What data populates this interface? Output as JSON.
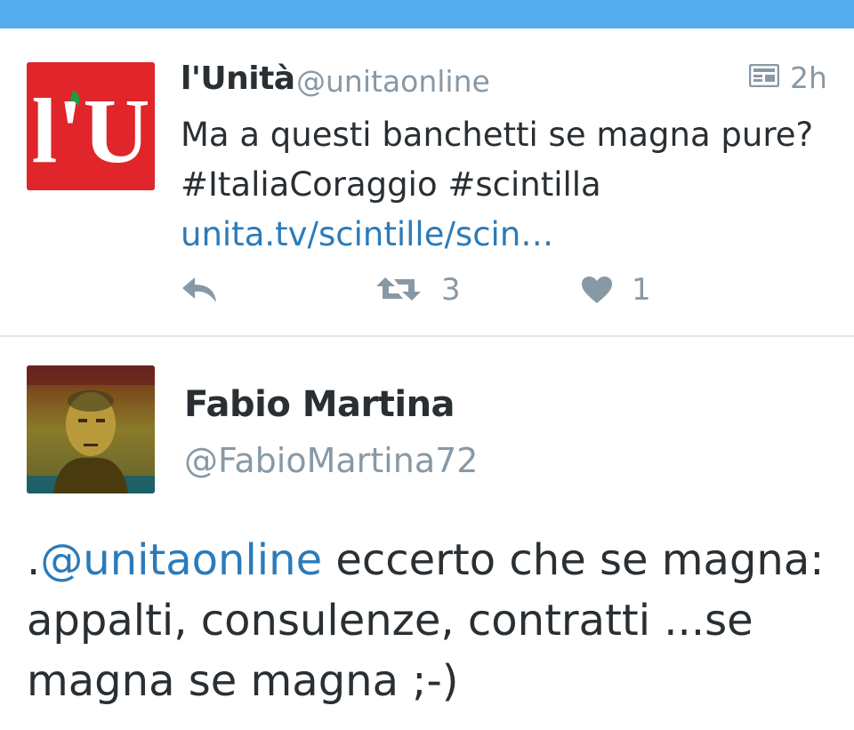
{
  "colors": {
    "topbar": "#55acee",
    "link": "#2b7bb9",
    "muted": "#8899a6",
    "text": "#292f33",
    "logo_red": "#e0252b"
  },
  "tweet1": {
    "avatar_text": "l'U",
    "name": "l'Unità",
    "handle": "@unitaonline",
    "card_icon": "summary-card-icon",
    "time": "2h",
    "text_line1": "Ma a questi banchetti se magna pure?",
    "text_line2": "#ItaliaCoraggio #scintilla",
    "link": "unita.tv/scintille/scin…",
    "actions": {
      "reply_icon": "reply-icon",
      "retweet_icon": "retweet-icon",
      "retweet_count": "3",
      "like_icon": "heart-icon",
      "like_count": "1"
    }
  },
  "tweet2": {
    "name": "Fabio Martina",
    "handle": "@FabioMartina72",
    "prefix": ".",
    "mention": "@unitaonline",
    "text_line1_rest": " eccerto che se magna:",
    "text_line2": "appalti, consulenze, contratti ...se",
    "text_line3": "magna se magna ;-)"
  }
}
